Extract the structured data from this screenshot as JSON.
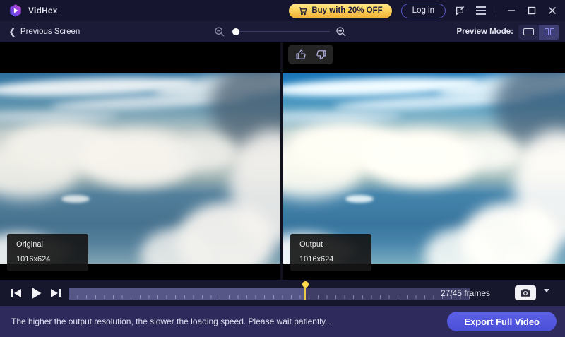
{
  "app": {
    "title": "VidHex"
  },
  "titlebar": {
    "buy_label": "Buy with 20% OFF",
    "login_label": "Log in"
  },
  "toolbar": {
    "back_label": "Previous Screen",
    "preview_mode_label": "Preview Mode:"
  },
  "viewer": {
    "original_label": "Original",
    "original_resolution": "1016x624",
    "output_label": "Output",
    "output_resolution": "1016x624"
  },
  "playback": {
    "frame_counter": "27/45 frames",
    "current_frame": 27,
    "total_frames": 45,
    "progress_percent": 59
  },
  "footer": {
    "notice": "The higher the output resolution, the slower the loading speed. Please wait patiently...",
    "export_label": "Export Full Video"
  },
  "colors": {
    "titlebar_bg": "#15152f",
    "toolbar_bg": "#1b1b38",
    "playbar_bg": "#16162d",
    "footer_bg": "#2e2b5c",
    "buy_gold": "#f2ad35",
    "accent_indigo": "#5055dd",
    "playhead_yellow": "#ffd84a",
    "timeline_played": "#565687",
    "timeline_rest": "#3e3e66"
  }
}
